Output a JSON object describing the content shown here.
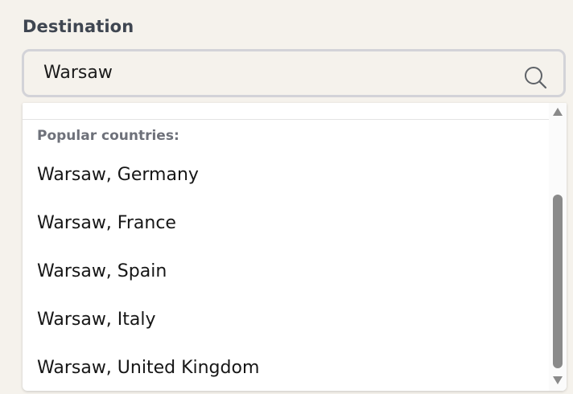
{
  "field": {
    "label": "Destination",
    "value": "Warsaw",
    "search_icon": "search-icon"
  },
  "dropdown": {
    "section_heading": "Popular countries:",
    "options": [
      "Warsaw, Germany",
      "Warsaw, France",
      "Warsaw, Spain",
      "Warsaw, Italy",
      "Warsaw, United Kingdom"
    ]
  },
  "colors": {
    "page_background": "#f5f2ec",
    "label_text": "#3f4651",
    "input_border": "#d3d3d8",
    "heading_text": "#6e717a",
    "scroll_thumb": "#8a8a8a"
  }
}
